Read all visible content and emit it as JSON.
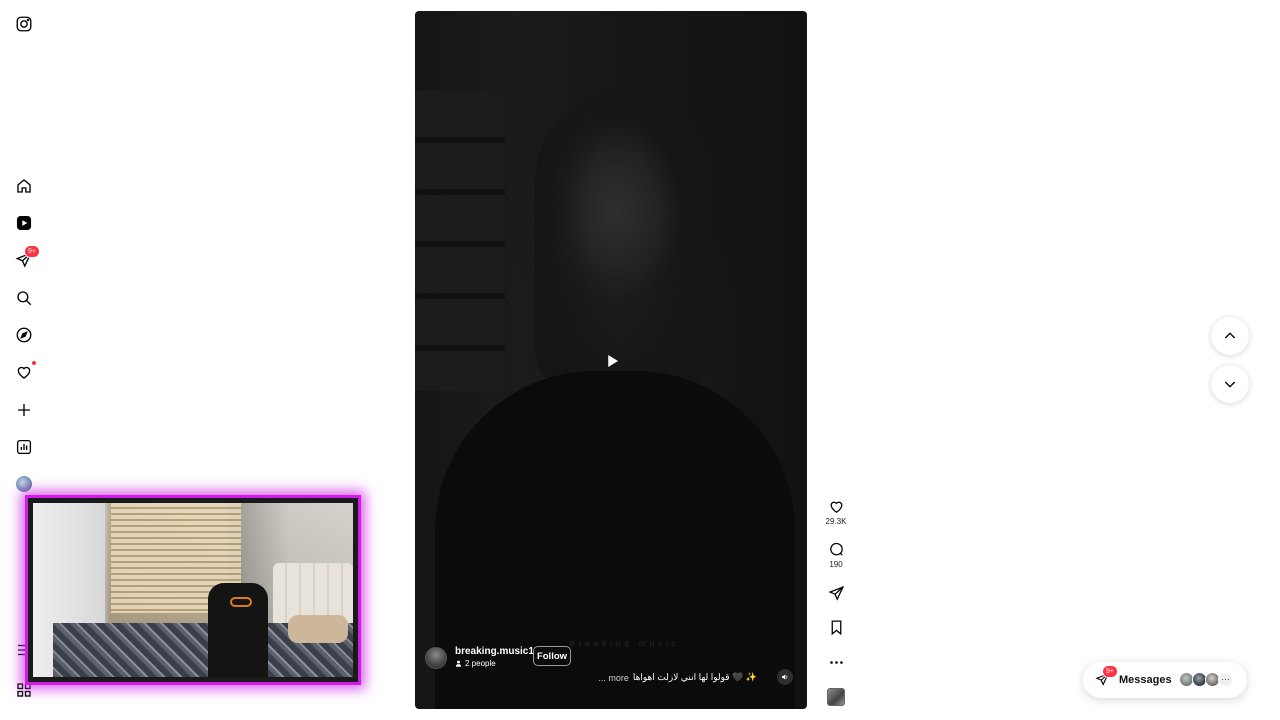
{
  "sidebar": {
    "items": [
      {
        "name": "instagram-logo-icon"
      },
      {
        "name": "home-icon"
      },
      {
        "name": "reels-icon"
      },
      {
        "name": "direct-messages-icon",
        "badge": "9+"
      },
      {
        "name": "search-icon"
      },
      {
        "name": "explore-icon"
      },
      {
        "name": "notifications-heart-icon",
        "dot": true
      },
      {
        "name": "create-plus-icon"
      },
      {
        "name": "dashboard-icon"
      },
      {
        "name": "profile-avatar"
      }
    ]
  },
  "reel": {
    "author": "breaking.music1",
    "collaborators": "2 people",
    "follow_label": "Follow",
    "caption": "قولوا لها انني لازلت اهواها 🖤 ✨",
    "more_label": "... more",
    "faint_overlay_text": "breaking.music"
  },
  "actions": {
    "likes": "29.3K",
    "comments": "190"
  },
  "messages": {
    "label": "Messages",
    "badge": "9+",
    "overflow": "···"
  },
  "colors": {
    "notification_red": "#ff3040",
    "webcam_border": "#d31be8"
  }
}
